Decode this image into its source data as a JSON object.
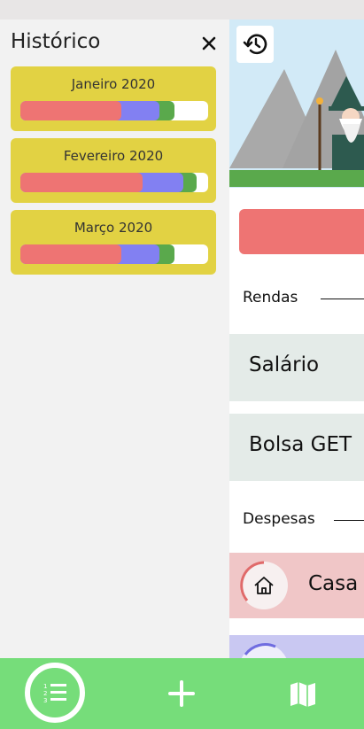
{
  "drawer": {
    "title": "Histórico",
    "months": [
      {
        "label": "Janeiro 2020",
        "segments": [
          0.54,
          0.2,
          0.08
        ]
      },
      {
        "label": "Fevereiro 2020",
        "segments": [
          0.65,
          0.22,
          0.07
        ]
      },
      {
        "label": "Março 2020",
        "segments": [
          0.54,
          0.2,
          0.08
        ]
      }
    ]
  },
  "colors": {
    "drawer_bg": "#f2f2f2",
    "card": "#e2d243",
    "expense": "#ee7473",
    "savings": "#8280f2",
    "income": "#5aa94c",
    "nav": "#76dd7a"
  },
  "main": {
    "sections": {
      "income_label": "Rendas",
      "expense_label": "Despesas"
    },
    "entries": [
      "Salário",
      "Bolsa GET"
    ],
    "category": "Casa"
  },
  "icons": {
    "close": "close-icon",
    "history": "history-icon",
    "list": "list-icon",
    "add": "add-icon",
    "map": "map-icon",
    "home": "home-icon"
  }
}
